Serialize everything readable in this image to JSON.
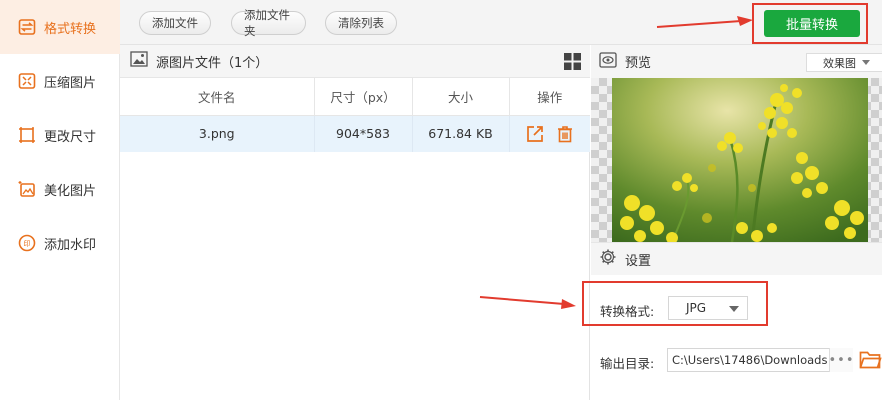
{
  "sidebar": {
    "items": [
      {
        "label": "格式转换",
        "icon": "format-convert-icon",
        "active": true
      },
      {
        "label": "压缩图片",
        "icon": "compress-icon"
      },
      {
        "label": "更改尺寸",
        "icon": "resize-icon"
      },
      {
        "label": "美化图片",
        "icon": "beautify-icon"
      },
      {
        "label": "添加水印",
        "icon": "watermark-icon"
      }
    ]
  },
  "toolbar": {
    "add_file": "添加文件",
    "add_folder": "添加文件夹",
    "clear_list": "清除列表",
    "batch_convert": "批量转换"
  },
  "file_panel": {
    "title": "源图片文件（1个）",
    "columns": [
      "文件名",
      "尺寸（px）",
      "大小",
      "操作"
    ],
    "rows": [
      {
        "name": "3.png",
        "size_px": "904*583",
        "filesize": "671.84 KB"
      }
    ]
  },
  "preview": {
    "title": "预览",
    "mode": "效果图"
  },
  "settings": {
    "title": "设置",
    "format_label": "转换格式:",
    "format_value": "JPG",
    "output_label": "输出目录:",
    "output_path": "C:\\Users\\17486\\Downloads",
    "more": "•••"
  },
  "colors": {
    "accent": "#e8711e",
    "primary": "#1aa83e",
    "highlight": "#e23b2e",
    "row_selected": "#e8f3fc"
  }
}
